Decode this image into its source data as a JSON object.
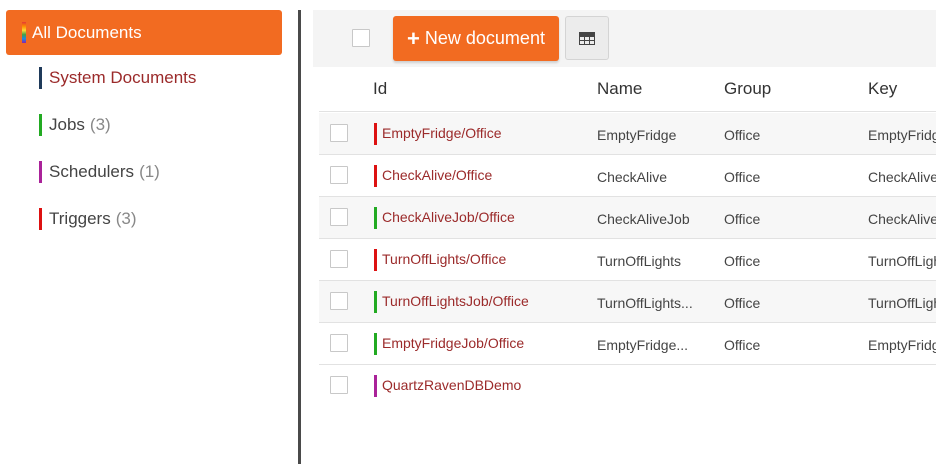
{
  "colors": {
    "accent": "#f26b21",
    "link": "#9b2a2a"
  },
  "sidebar": {
    "active": {
      "label": "All Documents"
    },
    "items": [
      {
        "label": "System Documents",
        "count": "",
        "color": "#1f3a5a"
      },
      {
        "label": "Jobs",
        "count": "(3)",
        "color": "#22aa22"
      },
      {
        "label": "Schedulers",
        "count": "(1)",
        "color": "#aa2299"
      },
      {
        "label": "Triggers",
        "count": "(3)",
        "color": "#dd1111"
      }
    ]
  },
  "toolbar": {
    "new_document_label": "New document",
    "plus_icon": "plus-icon",
    "grid_icon": "table-grid-icon"
  },
  "table": {
    "headers": {
      "id": "Id",
      "name": "Name",
      "group": "Group",
      "key": "Key"
    },
    "rows": [
      {
        "id": "EmptyFridge/Office",
        "name": "EmptyFridge",
        "group": "Office",
        "key": "EmptyFridge",
        "color": "#dd1111"
      },
      {
        "id": "CheckAlive/Office",
        "name": "CheckAlive",
        "group": "Office",
        "key": "CheckAlive",
        "color": "#dd1111"
      },
      {
        "id": "CheckAliveJob/Office",
        "name": "CheckAliveJob",
        "group": "Office",
        "key": "CheckAliveJob",
        "color": "#22aa22"
      },
      {
        "id": "TurnOffLights/Office",
        "name": "TurnOffLights",
        "group": "Office",
        "key": "TurnOffLights",
        "color": "#dd1111"
      },
      {
        "id": "TurnOffLightsJob/Office",
        "name": "TurnOffLights...",
        "group": "Office",
        "key": "TurnOffLightsJob",
        "color": "#22aa22"
      },
      {
        "id": "EmptyFridgeJob/Office",
        "name": "EmptyFridge...",
        "group": "Office",
        "key": "EmptyFridgeJob",
        "color": "#22aa22"
      },
      {
        "id": "QuartzRavenDBDemo",
        "name": "",
        "group": "",
        "key": "",
        "color": "#aa2299"
      }
    ]
  }
}
